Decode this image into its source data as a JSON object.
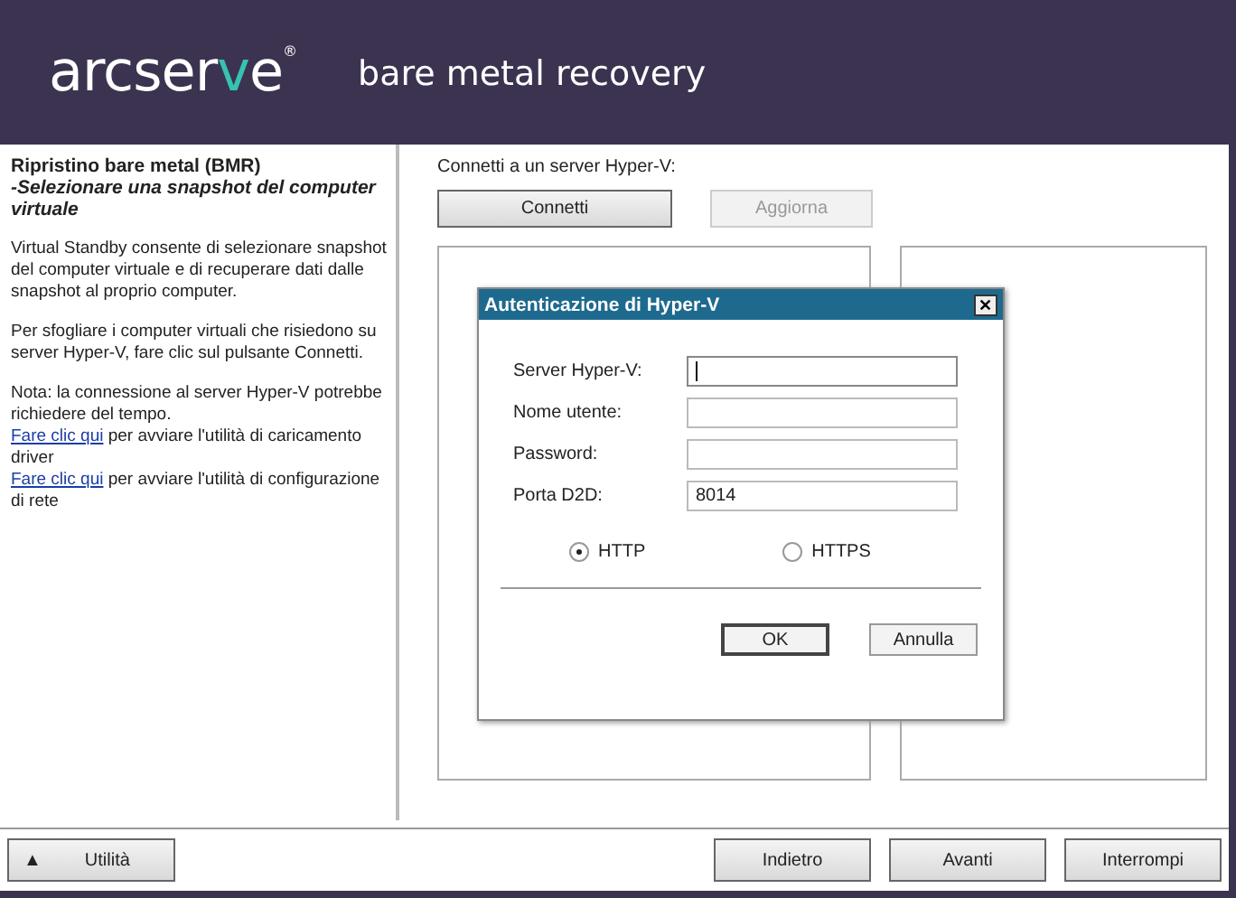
{
  "header": {
    "logo": {
      "before": "arcser",
      "accent": "v",
      "after": "e",
      "mark": "®"
    },
    "product": "bare metal recovery"
  },
  "sidebar": {
    "title": "Ripristino bare metal (BMR)",
    "subtitle": "-Selezionare una snapshot del computer virtuale",
    "paragraphs": [
      {
        "text": "Virtual Standby consente di selezionare snapshot del computer virtuale e di recuperare dati dalle snapshot al proprio computer."
      },
      {
        "text": "Per sfogliare i computer virtuali che risiedono su server Hyper-V, fare clic sul pulsante Connetti."
      },
      {
        "text": "Nota: la connessione al server Hyper-V potrebbe richiedere del tempo."
      }
    ],
    "links": [
      {
        "link": "Fare clic qui",
        "text": " per avviare l'utilità di caricamento driver"
      },
      {
        "link": "Fare clic qui",
        "text": " per avviare l'utilità di configurazione di rete"
      }
    ]
  },
  "main": {
    "prompt": "Connetti a un server Hyper-V:",
    "buttons": [
      {
        "label": "Connetti",
        "disabled": false
      },
      {
        "label": "Aggiorna",
        "disabled": true
      }
    ]
  },
  "dialog": {
    "title": "Autenticazione di Hyper-V",
    "close": "✕",
    "fields": [
      {
        "label": "Server Hyper-V:",
        "focused": true
      },
      {
        "label": "Nome utente:",
        "focused": false
      },
      {
        "label": "Password:",
        "focused": false
      },
      {
        "label": "Porta D2D:",
        "value": "8014",
        "focused": false
      }
    ],
    "protocols": [
      {
        "label": "HTTP",
        "selected": true
      },
      {
        "label": "HTTPS",
        "selected": false
      }
    ],
    "buttons": [
      {
        "label": "OK",
        "default": true
      },
      {
        "label": "Annulla",
        "default": false
      }
    ]
  },
  "footer": {
    "utility": {
      "icon": "▲",
      "label": "Utilità"
    },
    "buttons": [
      "Indietro",
      "Avanti",
      "Interrompi"
    ]
  }
}
